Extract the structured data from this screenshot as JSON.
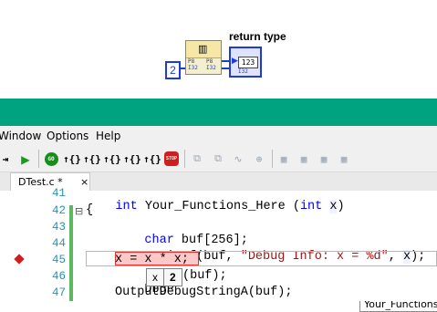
{
  "diagram": {
    "const_value": "2",
    "return_label": "return type",
    "indicator_value": "123",
    "indicator_type": "I32",
    "node_left_top": "P8",
    "node_left_bottom": "I32",
    "node_right_top": "P8",
    "node_right_bottom": "I32"
  },
  "menubar": {
    "window": "Window",
    "options": "Options",
    "help": "Help"
  },
  "toolbar": {
    "go": "GO",
    "stop": "STOP",
    "function_combo": "Your_Functions_"
  },
  "tab": {
    "label": "DTest.c *",
    "close": "×"
  },
  "editor": {
    "lines": [
      {
        "num": "41",
        "code": "int Your_Functions_Here (int x)"
      },
      {
        "num": "42",
        "code": "{"
      },
      {
        "num": "43",
        "code": "char buf[256];"
      },
      {
        "num": "44",
        "code": "sprintf(buf, \"Debug Info: x = %d\", x);"
      },
      {
        "num": "45",
        "code": "x = x * x;"
      },
      {
        "num": "46",
        "code": "DbgP"
      },
      {
        "num": "47",
        "code": "OutputDebugStringA(buf);"
      }
    ],
    "line46_tail": "(buf);",
    "fold": "⊟"
  },
  "tooltip": {
    "name": "x",
    "value": "2"
  },
  "colors": {
    "accent_bar": "#00a37f",
    "breakpoint": "#d11d1d",
    "keyword": "#0000ff",
    "string": "#a31515",
    "line_number": "#2b91af",
    "modified_marker": "#5cb85c"
  }
}
